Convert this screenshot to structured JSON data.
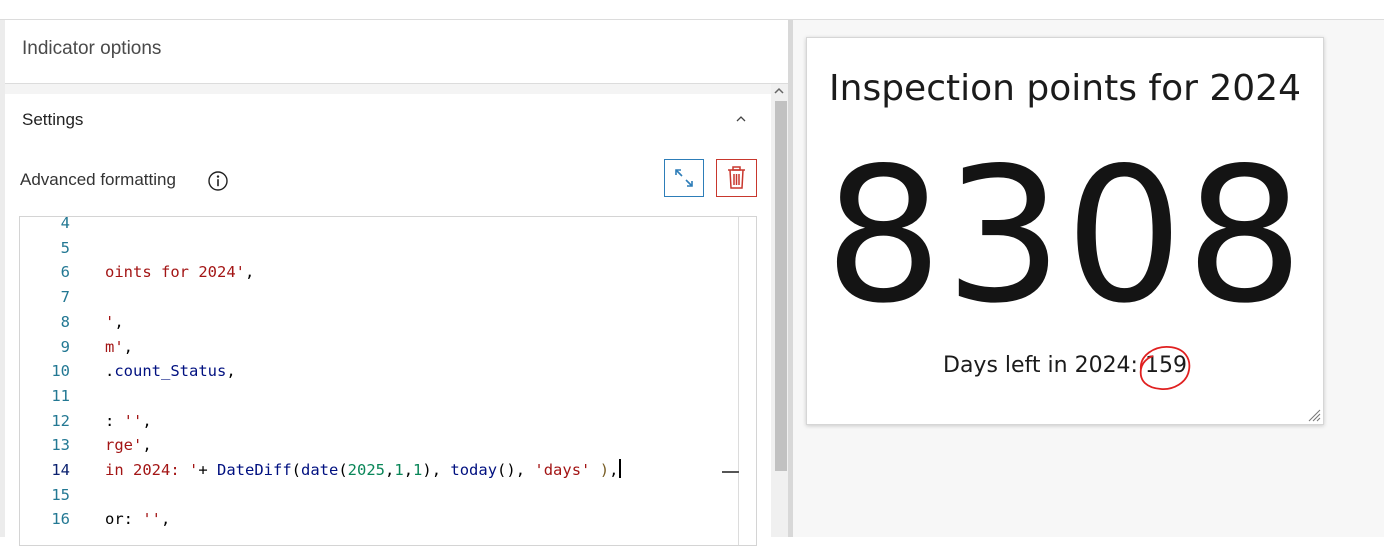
{
  "panel": {
    "title": "Indicator options",
    "settings_title": "Settings",
    "advanced_formatting_label": "Advanced formatting"
  },
  "icons": {
    "info": "info-circle-icon",
    "expand": "expand-arrows-icon",
    "delete": "trash-icon",
    "collapse": "chevron-up-icon"
  },
  "colors": {
    "expand_accent": "#2d7db8",
    "delete_accent": "#c8372d",
    "annotation_circle": "#e02020"
  },
  "editor": {
    "active_line": "14",
    "lines": [
      {
        "n": "4",
        "parts": []
      },
      {
        "n": "5",
        "parts": []
      },
      {
        "n": "6",
        "parts": [
          {
            "t": "oints for 2024'",
            "c": "s"
          },
          {
            "t": ",",
            "c": "d"
          }
        ]
      },
      {
        "n": "7",
        "parts": []
      },
      {
        "n": "8",
        "parts": [
          {
            "t": "'",
            "c": "s"
          },
          {
            "t": ",",
            "c": "d"
          }
        ]
      },
      {
        "n": "9",
        "parts": [
          {
            "t": "m'",
            "c": "s"
          },
          {
            "t": ",",
            "c": "d"
          }
        ]
      },
      {
        "n": "10",
        "parts": [
          {
            "t": ".",
            "c": "d"
          },
          {
            "t": "count_Status",
            "c": "f"
          },
          {
            "t": ",",
            "c": "d"
          }
        ]
      },
      {
        "n": "11",
        "parts": []
      },
      {
        "n": "12",
        "parts": [
          {
            "t": ": ",
            "c": "d"
          },
          {
            "t": "''",
            "c": "s"
          },
          {
            "t": ",",
            "c": "d"
          }
        ]
      },
      {
        "n": "13",
        "parts": [
          {
            "t": "rge'",
            "c": "s"
          },
          {
            "t": ",",
            "c": "d"
          }
        ]
      },
      {
        "n": "14",
        "parts": [
          {
            "t": "in 2024: '",
            "c": "s"
          },
          {
            "t": "+ ",
            "c": "d"
          },
          {
            "t": "DateDiff",
            "c": "f"
          },
          {
            "t": "(",
            "c": "d"
          },
          {
            "t": "date",
            "c": "f"
          },
          {
            "t": "(",
            "c": "d"
          },
          {
            "t": "2025",
            "c": "n"
          },
          {
            "t": ",",
            "c": "d"
          },
          {
            "t": "1",
            "c": "n"
          },
          {
            "t": ",",
            "c": "d"
          },
          {
            "t": "1",
            "c": "n"
          },
          {
            "t": "), ",
            "c": "d"
          },
          {
            "t": "today",
            "c": "f"
          },
          {
            "t": "(), ",
            "c": "d"
          },
          {
            "t": "'days'",
            "c": "s"
          },
          {
            "t": " ",
            "c": "d"
          },
          {
            "t": ")",
            "c": "fn"
          },
          {
            "t": ",",
            "c": "d"
          }
        ]
      },
      {
        "n": "15",
        "parts": []
      },
      {
        "n": "16",
        "parts": [
          {
            "t": "or: ",
            "c": "d"
          },
          {
            "t": "''",
            "c": "s"
          },
          {
            "t": ",",
            "c": "d"
          }
        ]
      }
    ]
  },
  "indicator": {
    "title": "Inspection points for 2024",
    "value": "8308",
    "bottom_label": "Days left in 2024:",
    "bottom_value": "159"
  }
}
